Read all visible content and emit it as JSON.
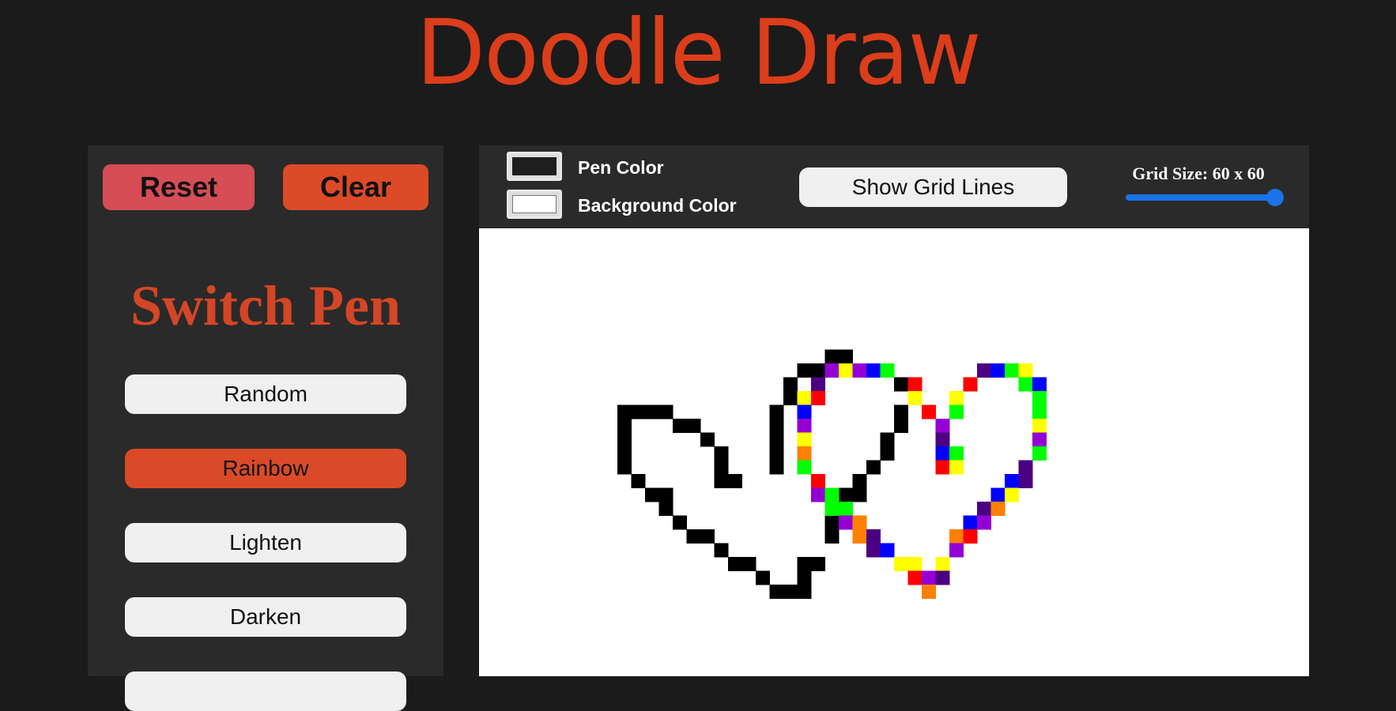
{
  "app_title": "Doodle Draw",
  "controls": {
    "reset_label": "Reset",
    "clear_label": "Clear"
  },
  "pen_panel": {
    "title": "Switch Pen",
    "modes": [
      {
        "label": "Random",
        "active": false
      },
      {
        "label": "Rainbow",
        "active": true
      },
      {
        "label": "Lighten",
        "active": false
      },
      {
        "label": "Darken",
        "active": false
      }
    ]
  },
  "toolbar": {
    "pen_color_label": "Pen Color",
    "pen_color": "#1e1e1e",
    "background_color_label": "Background Color",
    "background_color": "#ffffff",
    "grid_lines_label": "Show Grid Lines",
    "grid_size_label": "Grid Size: 60 x 60",
    "grid_size": 60,
    "grid_size_slider_fraction": 1.0
  },
  "colors": {
    "accent": "#dc3d1a",
    "panel_bg": "#2a2a2a",
    "page_bg": "#1b1b1b",
    "slider": "#1a73e8"
  },
  "canvas": {
    "grid_size": 60,
    "black_cells": [
      [
        25,
        3
      ],
      [
        26,
        3
      ],
      [
        23,
        4
      ],
      [
        24,
        4
      ],
      [
        27,
        4
      ],
      [
        28,
        4
      ],
      [
        29,
        4
      ],
      [
        22,
        5
      ],
      [
        30,
        5
      ],
      [
        22,
        6
      ],
      [
        10,
        7
      ],
      [
        11,
        7
      ],
      [
        12,
        7
      ],
      [
        13,
        7
      ],
      [
        21,
        7
      ],
      [
        30,
        7
      ],
      [
        10,
        8
      ],
      [
        14,
        8
      ],
      [
        15,
        8
      ],
      [
        21,
        8
      ],
      [
        30,
        8
      ],
      [
        10,
        9
      ],
      [
        16,
        9
      ],
      [
        21,
        9
      ],
      [
        29,
        9
      ],
      [
        10,
        10
      ],
      [
        17,
        10
      ],
      [
        21,
        10
      ],
      [
        29,
        10
      ],
      [
        10,
        11
      ],
      [
        17,
        11
      ],
      [
        21,
        11
      ],
      [
        28,
        11
      ],
      [
        11,
        12
      ],
      [
        17,
        12
      ],
      [
        18,
        12
      ],
      [
        27,
        12
      ],
      [
        12,
        13
      ],
      [
        13,
        13
      ],
      [
        26,
        13
      ],
      [
        27,
        13
      ],
      [
        13,
        14
      ],
      [
        14,
        15
      ],
      [
        25,
        15
      ],
      [
        15,
        16
      ],
      [
        16,
        16
      ],
      [
        25,
        16
      ],
      [
        17,
        17
      ],
      [
        18,
        18
      ],
      [
        19,
        18
      ],
      [
        23,
        18
      ],
      [
        24,
        18
      ],
      [
        20,
        19
      ],
      [
        23,
        19
      ],
      [
        21,
        20
      ],
      [
        22,
        20
      ],
      [
        23,
        20
      ]
    ],
    "colored_cells": [
      [
        25,
        4,
        "#9400d3"
      ],
      [
        26,
        4,
        "#ffff00"
      ],
      [
        27,
        4,
        "#9400d3"
      ],
      [
        28,
        4,
        "#0000ff"
      ],
      [
        29,
        4,
        "#00ff00"
      ],
      [
        36,
        4,
        "#4b0082"
      ],
      [
        37,
        4,
        "#0000ff"
      ],
      [
        38,
        4,
        "#00ff00"
      ],
      [
        39,
        4,
        "#ffff00"
      ],
      [
        24,
        5,
        "#4b0082"
      ],
      [
        31,
        5,
        "#ff0000"
      ],
      [
        35,
        5,
        "#ff0000"
      ],
      [
        39,
        5,
        "#00ff00"
      ],
      [
        40,
        5,
        "#0000ff"
      ],
      [
        23,
        6,
        "#ffff00"
      ],
      [
        24,
        6,
        "#ff0000"
      ],
      [
        31,
        6,
        "#ffff00"
      ],
      [
        34,
        6,
        "#ffff00"
      ],
      [
        40,
        6,
        "#00ff00"
      ],
      [
        23,
        7,
        "#0000ff"
      ],
      [
        32,
        7,
        "#ff0000"
      ],
      [
        34,
        7,
        "#00ff00"
      ],
      [
        40,
        7,
        "#00ff00"
      ],
      [
        23,
        8,
        "#9400d3"
      ],
      [
        33,
        8,
        "#9400d3"
      ],
      [
        40,
        8,
        "#ffff00"
      ],
      [
        23,
        9,
        "#ffff00"
      ],
      [
        33,
        9,
        "#4b0082"
      ],
      [
        40,
        9,
        "#9400d3"
      ],
      [
        23,
        10,
        "#ff7f00"
      ],
      [
        33,
        10,
        "#0000ff"
      ],
      [
        34,
        10,
        "#00ff00"
      ],
      [
        40,
        10,
        "#00ff00"
      ],
      [
        23,
        11,
        "#00ff00"
      ],
      [
        33,
        11,
        "#ff0000"
      ],
      [
        34,
        11,
        "#ffff00"
      ],
      [
        39,
        11,
        "#4b0082"
      ],
      [
        24,
        12,
        "#ff0000"
      ],
      [
        39,
        12,
        "#4b0082"
      ],
      [
        38,
        12,
        "#0000ff"
      ],
      [
        24,
        13,
        "#9400d3"
      ],
      [
        25,
        13,
        "#00ff00"
      ],
      [
        37,
        13,
        "#0000ff"
      ],
      [
        38,
        13,
        "#ffff00"
      ],
      [
        25,
        14,
        "#00ff00"
      ],
      [
        26,
        14,
        "#00ff00"
      ],
      [
        36,
        14,
        "#4b0082"
      ],
      [
        37,
        14,
        "#ff7f00"
      ],
      [
        26,
        15,
        "#9400d3"
      ],
      [
        27,
        15,
        "#ff7f00"
      ],
      [
        35,
        15,
        "#0000ff"
      ],
      [
        36,
        15,
        "#9400d3"
      ],
      [
        27,
        16,
        "#ff7f00"
      ],
      [
        28,
        16,
        "#4b0082"
      ],
      [
        34,
        16,
        "#ff7f00"
      ],
      [
        35,
        16,
        "#ff0000"
      ],
      [
        28,
        17,
        "#4b0082"
      ],
      [
        29,
        17,
        "#0000ff"
      ],
      [
        34,
        17,
        "#9400d3"
      ],
      [
        30,
        18,
        "#ffff00"
      ],
      [
        31,
        18,
        "#ffff00"
      ],
      [
        33,
        18,
        "#ffff00"
      ],
      [
        31,
        19,
        "#ff0000"
      ],
      [
        32,
        19,
        "#9400d3"
      ],
      [
        33,
        19,
        "#4b0082"
      ],
      [
        32,
        20,
        "#ff7f00"
      ]
    ]
  }
}
